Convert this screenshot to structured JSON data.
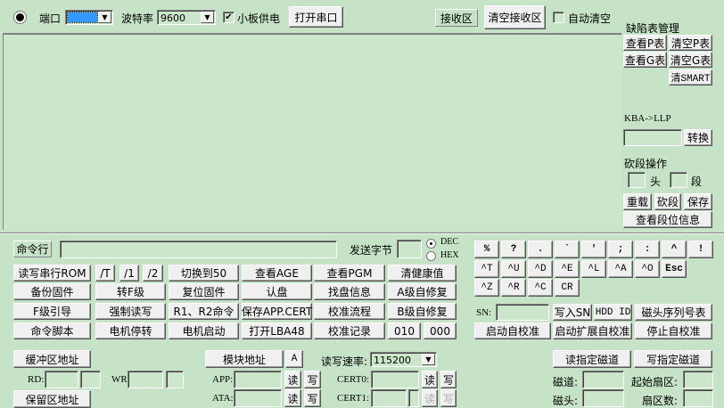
{
  "top": {
    "port_label": "端口",
    "baud_label": "波特率",
    "baud_value": "9600",
    "power_label": "小板供电",
    "power_checked": true,
    "open_port": "打开串口",
    "recv_label": "接收区",
    "clear_recv": "清空接收区",
    "auto_clear_label": "自动清空",
    "auto_clear_checked": false
  },
  "defect": {
    "title": "缺陷表管理",
    "view_p": "查看P表",
    "clear_p": "清空P表",
    "view_g": "查看G表",
    "clear_g": "清空G表",
    "clear_smart": "清SMART"
  },
  "kba": {
    "label": "KBA->LLP",
    "convert": "转换"
  },
  "cut": {
    "title": "砍段操作",
    "head": "头",
    "seg": "段",
    "reload": "重载",
    "cut": "砍段",
    "save": "保存",
    "view_seg": "查看段位信息"
  },
  "cmd": {
    "label": "命令行",
    "send_bytes": "发送字节",
    "dec": "DEC",
    "hex": "HEX"
  },
  "grid": [
    [
      "读写串行ROM",
      "/T",
      "/1",
      "/2",
      "切换到50",
      "查看AGE",
      "查看PGM",
      "清健康值"
    ],
    [
      "备份固件",
      "转F级",
      "复位固件",
      "认盘",
      "找盘信息",
      "A级自修复"
    ],
    [
      "F级引导",
      "强制读写",
      "R1、R2命令",
      "保存APP.CERT",
      "校准流程",
      "B级自修复"
    ],
    [
      "命令脚本",
      "电机停转",
      "电机启动",
      "打开LBA48",
      "校准记录",
      "010",
      "000"
    ]
  ],
  "keys": [
    [
      "%",
      "?",
      ".",
      "`",
      "'",
      ";",
      ":",
      "^",
      "!"
    ],
    [
      "^T",
      "^U",
      "^D",
      "^E",
      "^L",
      "^A",
      "^O",
      "Esc"
    ],
    [
      "^Z",
      "^R",
      "^C",
      "CR"
    ]
  ],
  "sn": {
    "label": "SN:",
    "write_sn": "写入SN",
    "hdd_id": "HDD ID",
    "head_sn_table": "磁头序列号表",
    "start_cal": "启动自校准",
    "start_ext_cal": "启动扩展自校准",
    "stop_cal": "停止自校准"
  },
  "bottom": {
    "buffer_addr": "缓冲区地址",
    "rd": "RD:",
    "wr": "WR:",
    "reserved_addr": "保留区地址",
    "module_addr": "模块地址",
    "a": "A",
    "rw_rate_label": "读写速率:",
    "rw_rate": "115200",
    "app": "APP:",
    "ata": "ATA:",
    "cert0": "CERT0:",
    "cert1": "CERT1:",
    "read": "读",
    "write": "写",
    "read_track": "读指定磁道",
    "write_track": "写指定磁道",
    "track": "磁道:",
    "start_sector": "起始扇区:",
    "head": "磁头:",
    "sector_count": "扇区数:"
  }
}
